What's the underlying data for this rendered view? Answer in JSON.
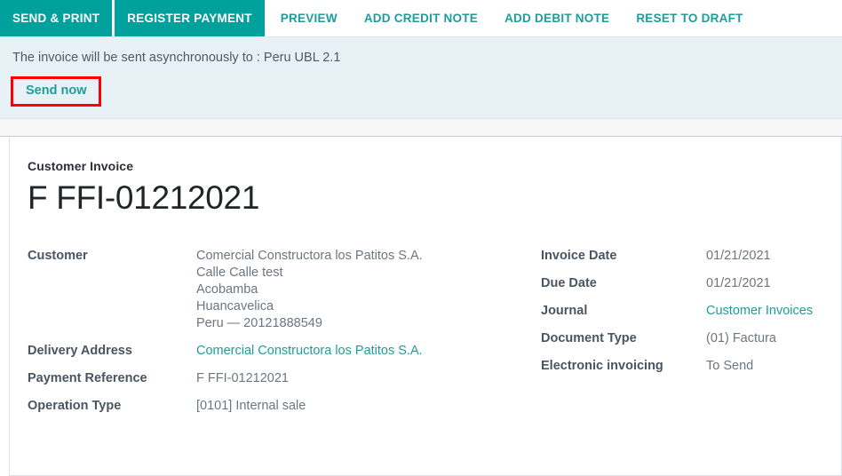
{
  "theme": {
    "accent": "#00a09d",
    "link": "#1f9c9a",
    "banner_bg": "#e7f1f6",
    "highlight": "#ff0000",
    "label_color": "#4a5561",
    "value_color": "#6b7680"
  },
  "toolbar": {
    "primary_buttons": [
      {
        "label": "SEND & PRINT"
      },
      {
        "label": "REGISTER PAYMENT"
      }
    ],
    "link_buttons": [
      {
        "label": "PREVIEW"
      },
      {
        "label": "ADD CREDIT NOTE"
      },
      {
        "label": "ADD DEBIT NOTE"
      },
      {
        "label": "RESET TO DRAFT"
      }
    ]
  },
  "banner": {
    "message": "The invoice will be sent asynchronously to : Peru UBL 2.1",
    "action_label": "Send now"
  },
  "sheet": {
    "subtitle": "Customer Invoice",
    "title": "F FFI-01212021",
    "left_fields": [
      {
        "label": "Customer",
        "value_link": "Comercial Constructora los Patitos S.A.",
        "address_lines": [
          "Calle Calle test",
          "Acobamba",
          "Huancavelica",
          "Peru — 20121888549"
        ]
      },
      {
        "label": "Delivery Address",
        "value_link": "Comercial Constructora los Patitos S.A."
      },
      {
        "label": "Payment Reference",
        "value": "F FFI-01212021"
      },
      {
        "label": "Operation Type",
        "value": "[0101] Internal sale"
      }
    ],
    "right_fields": [
      {
        "label": "Invoice Date",
        "value": "01/21/2021"
      },
      {
        "label": "Due Date",
        "value": "01/21/2021"
      },
      {
        "label": "Journal",
        "value_link": "Customer Invoices"
      },
      {
        "label": "Document Type",
        "value": "(01) Factura"
      },
      {
        "label": "Electronic invoicing",
        "value": "To Send"
      }
    ]
  }
}
